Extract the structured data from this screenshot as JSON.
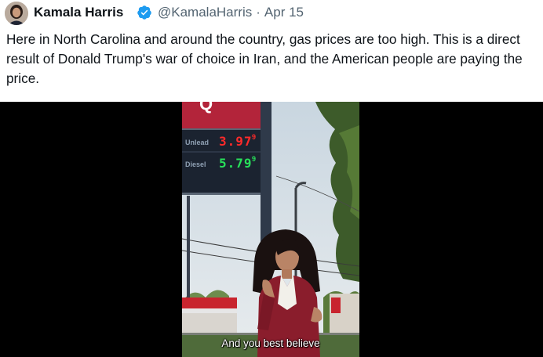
{
  "tweet": {
    "author_name": "Kamala Harris",
    "handle": "@KamalaHarris",
    "separator": "·",
    "date": "Apr 15",
    "text": "Here in North Carolina and around the country, gas prices are too high. This is a direct result of Donald Trump's war of choice in Iran, and the American people are paying the price.",
    "verified_icon": "verified-badge-icon",
    "badge_color": "#1d9bf0"
  },
  "video": {
    "sign": {
      "unlead_label": "Unlead",
      "unlead_price": "3.97",
      "unlead_fraction": "9",
      "diesel_label": "Diesel",
      "diesel_price": "5.79",
      "diesel_fraction": "9",
      "unlead_color": "#ff2a2a",
      "diesel_color": "#28e05a"
    },
    "caption": "And you best believe"
  }
}
